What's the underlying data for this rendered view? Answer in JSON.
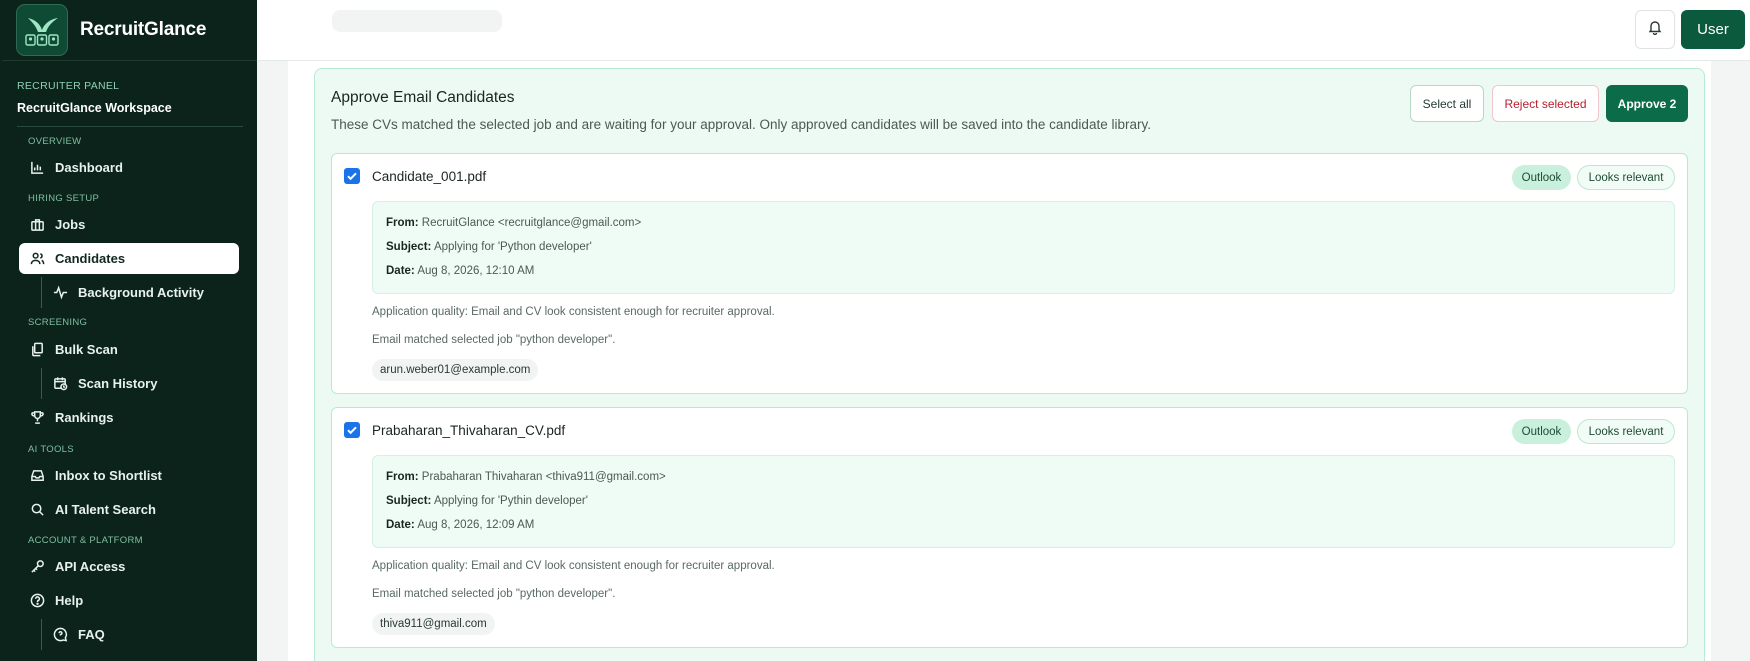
{
  "app": {
    "name": "RecruitGlance"
  },
  "sidebar": {
    "panel_label": "RECRUITER PANEL",
    "workspace": "RecruitGlance Workspace",
    "sections": {
      "overview": "OVERVIEW",
      "hiring_setup": "HIRING SETUP",
      "screening": "SCREENING",
      "ai_tools": "AI TOOLS",
      "account_platform": "ACCOUNT & PLATFORM"
    },
    "items": {
      "dashboard": "Dashboard",
      "jobs": "Jobs",
      "candidates": "Candidates",
      "background_activity": "Background Activity",
      "bulk_scan": "Bulk Scan",
      "scan_history": "Scan History",
      "rankings": "Rankings",
      "inbox_to_shortlist": "Inbox to Shortlist",
      "ai_talent_search": "AI Talent Search",
      "api_access": "API Access",
      "help": "Help",
      "faq": "FAQ"
    },
    "active_item": "Candidates"
  },
  "header": {
    "user_label": "User"
  },
  "approval": {
    "title": "Approve Email Candidates",
    "description": "These CVs matched the selected job and are waiting for your approval. Only approved candidates will be saved into the candidate library.",
    "select_all_label": "Select all",
    "reject_label": "Reject selected",
    "approve_label": "Approve 2",
    "candidates": [
      {
        "file": "Candidate_001.pdf",
        "checked": true,
        "source": "Outlook",
        "relevance": "Looks relevant",
        "from_label": "From:",
        "from": "RecruitGlance <recruitglance@gmail.com>",
        "subject_label": "Subject:",
        "subject": "Applying for 'Python developer'",
        "date_label": "Date:",
        "date": "Aug 8, 2026, 12:10 AM",
        "quality": "Application quality: Email and CV look consistent enough for recruiter approval.",
        "match": "Email matched selected job \"python developer\".",
        "email": "arun.weber01@example.com"
      },
      {
        "file": "Prabaharan_Thivaharan_CV.pdf",
        "checked": true,
        "source": "Outlook",
        "relevance": "Looks relevant",
        "from_label": "From:",
        "from": "Prabaharan Thivaharan <thiva911@gmail.com>",
        "subject_label": "Subject:",
        "subject": "Applying for 'Pythin developer'",
        "date_label": "Date:",
        "date": "Aug 8, 2026, 12:09 AM",
        "quality": "Application quality: Email and CV look consistent enough for recruiter approval.",
        "match": "Email matched selected job \"python developer\".",
        "email": "thiva911@gmail.com"
      }
    ]
  },
  "colors": {
    "sidebar_bg": "#0b231a",
    "accent": "#0c6b48",
    "panel_bg": "#ecfaf3",
    "reject": "#b5202e",
    "checkbox": "#1a73e8"
  }
}
